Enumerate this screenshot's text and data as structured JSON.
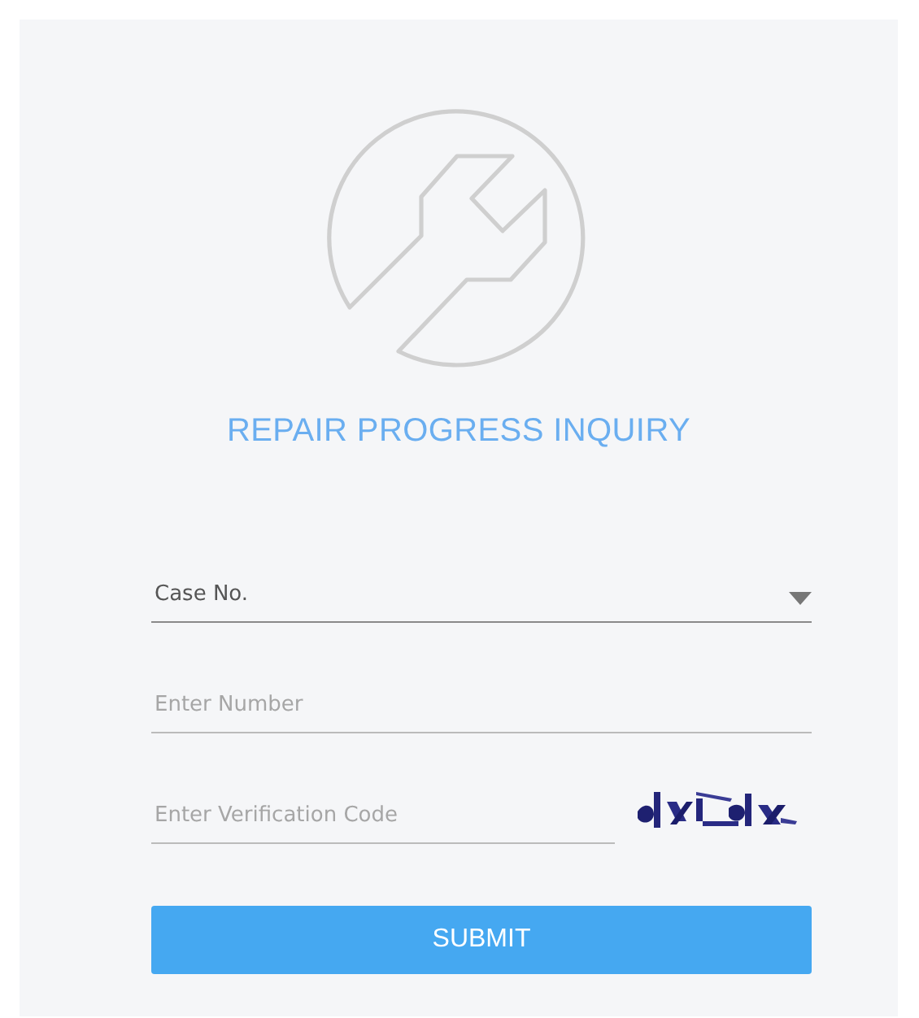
{
  "title": "REPAIR PROGRESS INQUIRY",
  "case_select": {
    "value": "Case No."
  },
  "number_field": {
    "placeholder": "Enter Number"
  },
  "verification_field": {
    "placeholder": "Enter Verification Code"
  },
  "submit_button": {
    "label": "SUBMIT"
  }
}
